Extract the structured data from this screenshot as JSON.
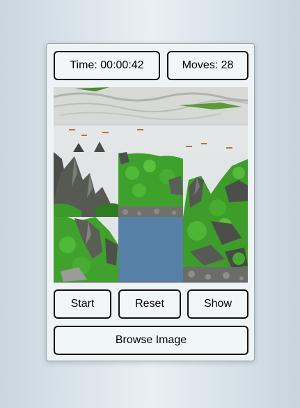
{
  "game": {
    "time_label": "Time: 00:00:42",
    "moves_label": "Moves: 28"
  },
  "board": {
    "rows": 3,
    "cols": 3,
    "blank_tile_color": "#5680a6",
    "image_subject": "aquarium aquascape with rocks and green plants"
  },
  "controls": {
    "start_label": "Start",
    "reset_label": "Reset",
    "show_label": "Show",
    "browse_label": "Browse Image"
  }
}
